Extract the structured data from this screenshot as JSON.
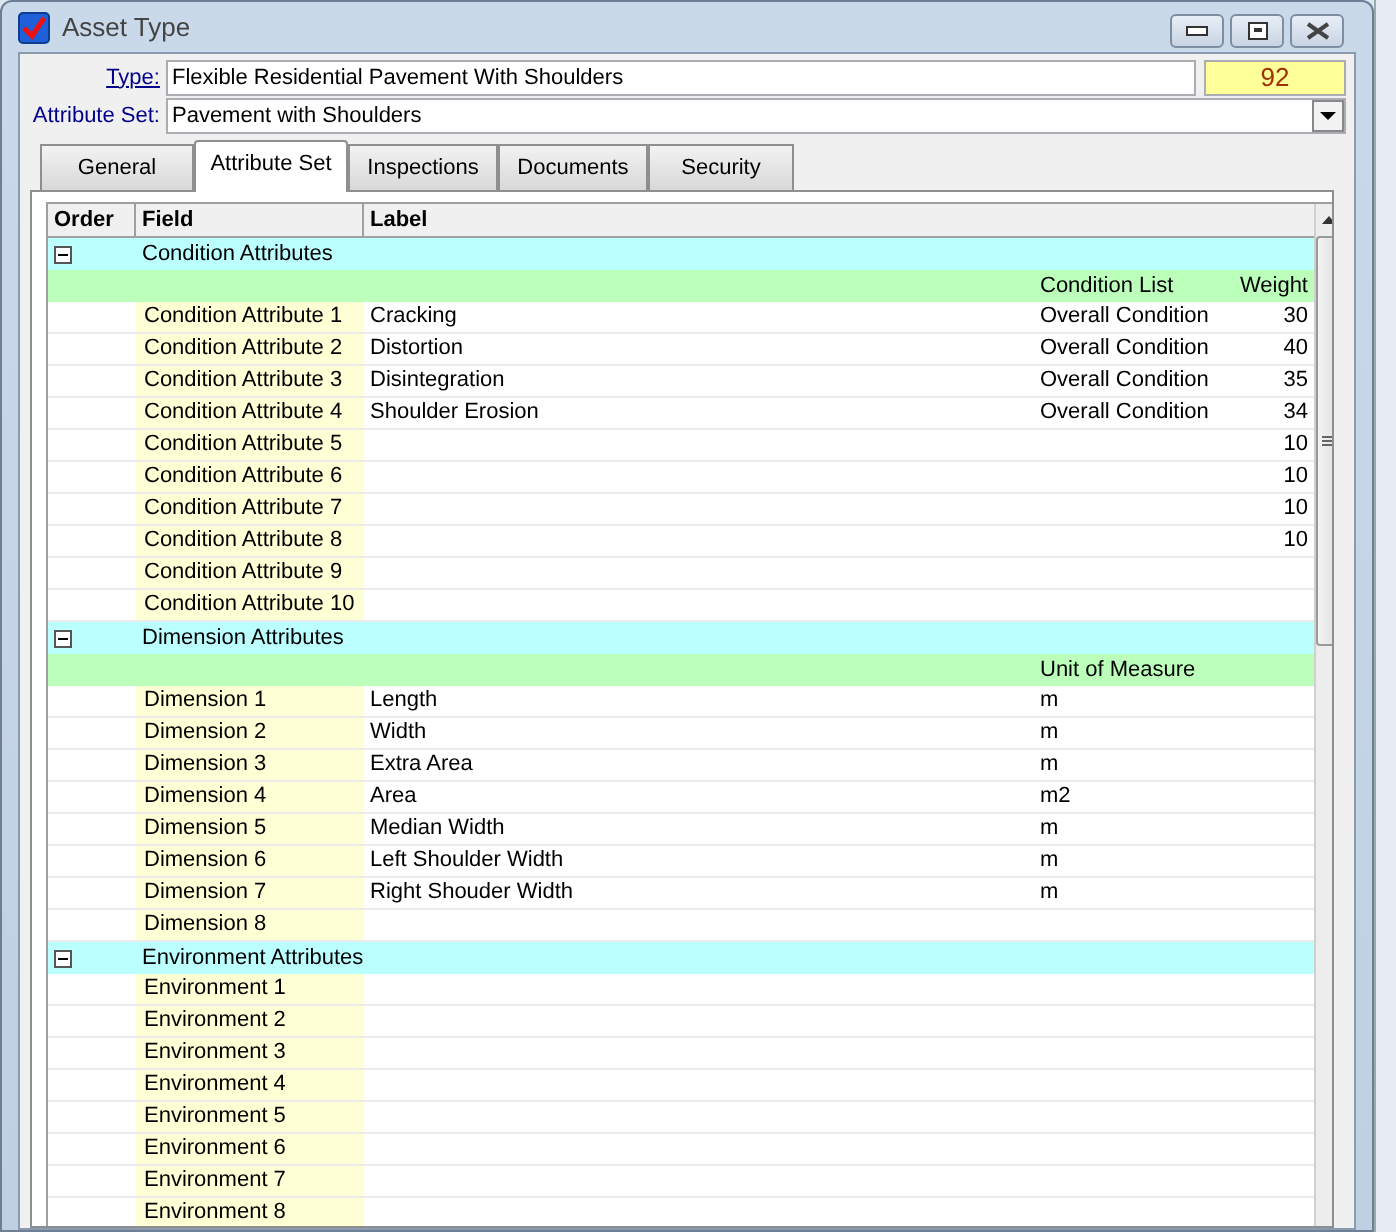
{
  "window": {
    "title": "Asset Type"
  },
  "type": {
    "label": "Type:",
    "value": "Flexible Residential Pavement With Shoulders",
    "number": "92"
  },
  "attribute_set": {
    "label": "Attribute Set:",
    "value": "Pavement with Shoulders"
  },
  "tabs": [
    {
      "label": "General",
      "selected": false
    },
    {
      "label": "Attribute Set",
      "selected": true
    },
    {
      "label": "Inspections",
      "selected": false
    },
    {
      "label": "Documents",
      "selected": false
    },
    {
      "label": "Security",
      "selected": false
    }
  ],
  "grid": {
    "columns": [
      "Order",
      "Field",
      "Label"
    ],
    "groups": [
      {
        "title": "Condition Attributes",
        "expanded": true,
        "subheader": {
          "column_4": "Condition List",
          "column_5": "Weight"
        },
        "rows": [
          {
            "field": "Condition Attribute 1",
            "label": "Cracking",
            "column_4": "Overall Condition",
            "column_5": "30"
          },
          {
            "field": "Condition Attribute 2",
            "label": "Distortion",
            "column_4": "Overall Condition",
            "column_5": "40"
          },
          {
            "field": "Condition Attribute 3",
            "label": "Disintegration",
            "column_4": "Overall Condition",
            "column_5": "35"
          },
          {
            "field": "Condition Attribute 4",
            "label": "Shoulder Erosion",
            "column_4": "Overall Condition",
            "column_5": "34"
          },
          {
            "field": "Condition Attribute 5",
            "column_5": "10"
          },
          {
            "field": "Condition Attribute 6",
            "column_5": "10"
          },
          {
            "field": "Condition Attribute 7",
            "column_5": "10"
          },
          {
            "field": "Condition Attribute 8",
            "column_5": "10"
          },
          {
            "field": "Condition Attribute 9"
          },
          {
            "field": "Condition Attribute 10"
          }
        ]
      },
      {
        "title": "Dimension Attributes",
        "expanded": true,
        "subheader": {
          "column_4": "Unit of Measure"
        },
        "rows": [
          {
            "field": "Dimension 1",
            "label": "Length",
            "column_4": "m"
          },
          {
            "field": "Dimension 2",
            "label": "Width",
            "column_4": "m"
          },
          {
            "field": "Dimension 3",
            "label": "Extra Area",
            "column_4": "m"
          },
          {
            "field": "Dimension 4",
            "label": "Area",
            "column_4": "m2"
          },
          {
            "field": "Dimension 5",
            "label": "Median Width",
            "column_4": "m"
          },
          {
            "field": "Dimension 6",
            "label": "Left Shoulder Width",
            "column_4": "m"
          },
          {
            "field": "Dimension 7",
            "label": "Right Shouder Width",
            "column_4": "m"
          },
          {
            "field": "Dimension 8"
          }
        ]
      },
      {
        "title": "Environment Attributes",
        "expanded": true,
        "rows": [
          {
            "field": "Environment 1"
          },
          {
            "field": "Environment 2"
          },
          {
            "field": "Environment 3"
          },
          {
            "field": "Environment 4"
          },
          {
            "field": "Environment 5"
          },
          {
            "field": "Environment 6"
          },
          {
            "field": "Environment 7"
          },
          {
            "field": "Environment 8"
          }
        ]
      }
    ]
  }
}
